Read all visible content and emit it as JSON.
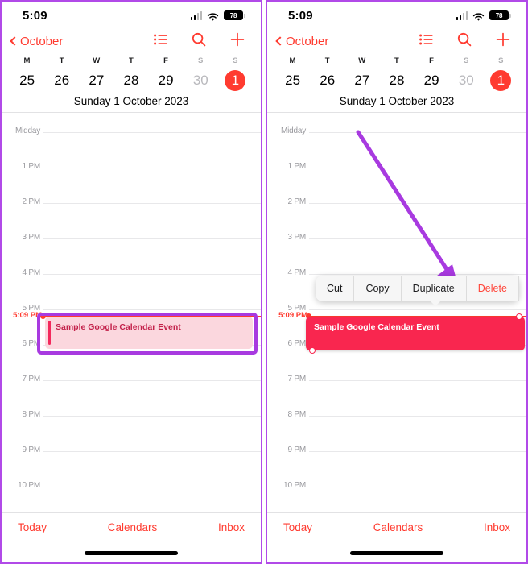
{
  "panels": [
    {
      "id": "left",
      "status": {
        "time": "5:09",
        "battery": "78",
        "signal_icon": "cellular-signal-icon",
        "wifi_icon": "wifi-icon",
        "battery_icon": "battery-icon"
      },
      "nav": {
        "back_label": "October",
        "back_icon": "chevron-left-icon",
        "actions": [
          {
            "name": "list-view-icon",
            "label": "List"
          },
          {
            "name": "search-icon",
            "label": "Search"
          },
          {
            "name": "add-event-icon",
            "label": "Add"
          }
        ]
      },
      "week": {
        "dows": [
          "M",
          "T",
          "W",
          "T",
          "F",
          "S",
          "S"
        ],
        "days": [
          {
            "num": "25",
            "state": "normal"
          },
          {
            "num": "26",
            "state": "normal"
          },
          {
            "num": "27",
            "state": "normal"
          },
          {
            "num": "28",
            "state": "normal"
          },
          {
            "num": "29",
            "state": "normal"
          },
          {
            "num": "30",
            "state": "dim"
          },
          {
            "num": "1",
            "state": "selected"
          }
        ],
        "date_title": "Sunday  1 October 2023"
      },
      "hours": [
        "Midday",
        "1 PM",
        "2 PM",
        "3 PM",
        "4 PM",
        "5 PM",
        "6 PM",
        "7 PM",
        "8 PM",
        "9 PM",
        "10 PM"
      ],
      "now_label": "5:09 PM",
      "event": {
        "title": "Sample Google Calendar Event",
        "selected": false
      },
      "annotation": {
        "type": "highlight-box",
        "color": "#a83ae0"
      },
      "tabs": [
        {
          "name": "tab-today",
          "label": "Today"
        },
        {
          "name": "tab-calendars",
          "label": "Calendars"
        },
        {
          "name": "tab-inbox",
          "label": "Inbox"
        }
      ]
    },
    {
      "id": "right",
      "status": {
        "time": "5:09",
        "battery": "78",
        "signal_icon": "cellular-signal-icon",
        "wifi_icon": "wifi-icon",
        "battery_icon": "battery-icon"
      },
      "nav": {
        "back_label": "October",
        "back_icon": "chevron-left-icon",
        "actions": [
          {
            "name": "list-view-icon",
            "label": "List"
          },
          {
            "name": "search-icon",
            "label": "Search"
          },
          {
            "name": "add-event-icon",
            "label": "Add"
          }
        ]
      },
      "week": {
        "dows": [
          "M",
          "T",
          "W",
          "T",
          "F",
          "S",
          "S"
        ],
        "days": [
          {
            "num": "25",
            "state": "normal"
          },
          {
            "num": "26",
            "state": "normal"
          },
          {
            "num": "27",
            "state": "normal"
          },
          {
            "num": "28",
            "state": "normal"
          },
          {
            "num": "29",
            "state": "normal"
          },
          {
            "num": "30",
            "state": "dim"
          },
          {
            "num": "1",
            "state": "selected"
          }
        ],
        "date_title": "Sunday  1 October 2023"
      },
      "hours": [
        "Midday",
        "1 PM",
        "2 PM",
        "3 PM",
        "4 PM",
        "5 PM",
        "6 PM",
        "7 PM",
        "8 PM",
        "9 PM",
        "10 PM"
      ],
      "now_label": "5:09 PM",
      "event": {
        "title": "Sample Google Calendar Event",
        "selected": true
      },
      "context_menu": [
        {
          "name": "menu-item-cut",
          "label": "Cut",
          "style": "normal"
        },
        {
          "name": "menu-item-copy",
          "label": "Copy",
          "style": "normal"
        },
        {
          "name": "menu-item-duplicate",
          "label": "Duplicate",
          "style": "normal"
        },
        {
          "name": "menu-item-delete",
          "label": "Delete",
          "style": "danger"
        }
      ],
      "annotation": {
        "type": "arrow",
        "color": "#a83ae0",
        "points_to": "menu-item-duplicate"
      },
      "tabs": [
        {
          "name": "tab-today",
          "label": "Today"
        },
        {
          "name": "tab-calendars",
          "label": "Calendars"
        },
        {
          "name": "tab-inbox",
          "label": "Inbox"
        }
      ]
    }
  ],
  "colors": {
    "accent_red": "#ff3b30",
    "event_selected": "#f9264f",
    "event_unselected": "#fbd7de",
    "annotation_purple": "#a83ae0"
  }
}
